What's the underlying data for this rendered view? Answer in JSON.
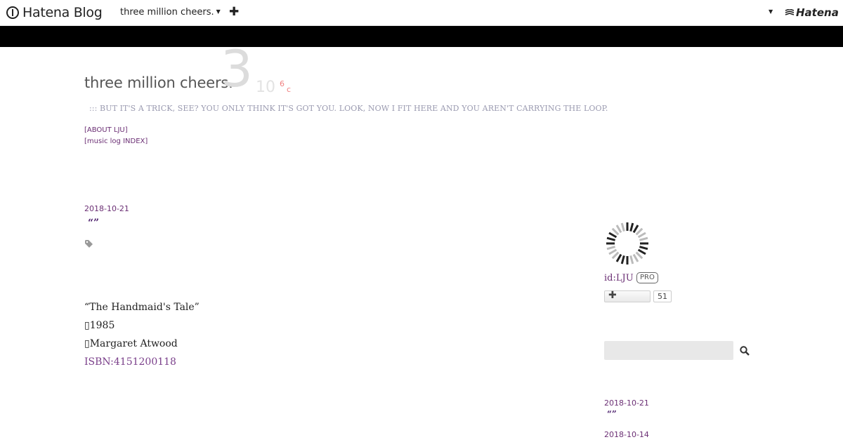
{
  "topbar": {
    "brand": "Hatena Blog",
    "blog_name": "three million cheers.",
    "add_icon": "plus-icon",
    "account_caret": "caret-down-icon",
    "hatena_logo": "Hatena"
  },
  "header": {
    "title": "three million cheers.",
    "deco_big": "3",
    "deco_ten": "10",
    "deco_exp": "6",
    "deco_c": "c",
    "description": "::: BUT IT'S A TRICK, SEE? YOU ONLY THINK IT'S GOT YOU. LOOK, NOW I FIT HERE AND YOU AREN'T CARRYING THE LOOP.",
    "links": [
      "[ABOUT LJU]",
      "[music log INDEX]"
    ]
  },
  "entry": {
    "date": "2018-10-21",
    "title": "“”",
    "tag_icon": "tag-icon",
    "lines": [
      "“The Handmaid's Tale”",
      "1985",
      "Margaret Atwood"
    ],
    "isbn": "ISBN:4151200118"
  },
  "sidebar": {
    "profile_id": "id:LJU",
    "badge": "PRO",
    "follow_icon": "plus-icon",
    "follow_count": "51",
    "search_icon": "search-icon",
    "recent": [
      {
        "date": "2018-10-21",
        "title": "“”"
      },
      {
        "date": "2018-10-14",
        "title": ""
      }
    ]
  },
  "colors": {
    "link": "#6b2f74",
    "title_link": "#4a1d6b",
    "description": "#9a9ab0",
    "band": "#000000",
    "accent_red": "#f08080"
  }
}
